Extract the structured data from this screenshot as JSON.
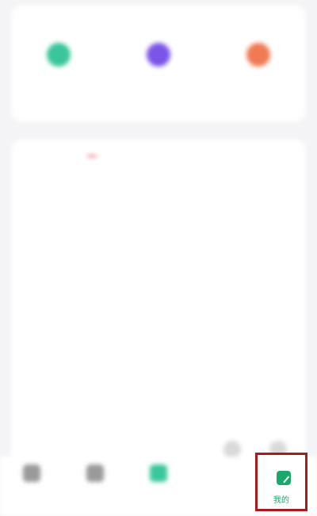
{
  "colors": {
    "accent_green": "#1aa86b",
    "badge_red": "#e7465b",
    "highlight_border": "#a71d1d"
  },
  "tabbar": {
    "active_tab_label": "我的",
    "active_tab_icon": "leaf-icon"
  }
}
